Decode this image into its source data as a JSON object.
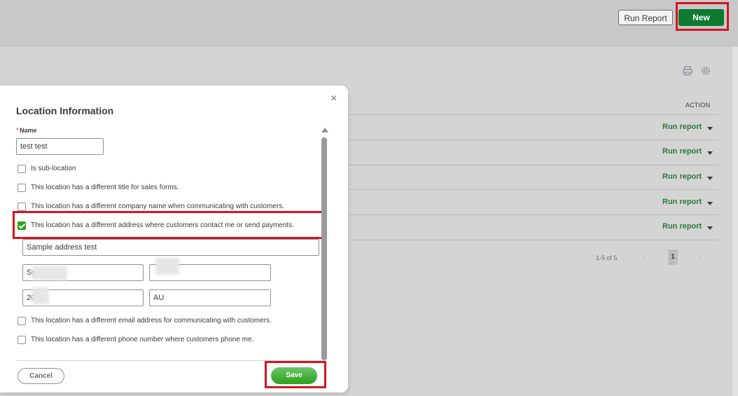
{
  "header": {
    "run_report_label": "Run Report",
    "new_label": "New"
  },
  "table": {
    "action_header": "ACTION",
    "rows": [
      {
        "action": "Run report"
      },
      {
        "action": "Run report"
      },
      {
        "action": "Run report"
      },
      {
        "action": "Run report"
      },
      {
        "action": "Run report"
      }
    ],
    "pager": {
      "range": "1-5 of 5",
      "prev": "‹",
      "current": "1",
      "next": "›"
    }
  },
  "dialog": {
    "title": "Location Information",
    "required_mark": "*",
    "name_label": "Name",
    "name_value": "test test",
    "checkboxes": [
      {
        "label": "Is sub-location",
        "checked": false
      },
      {
        "label": "This location has a different title for sales forms.",
        "checked": false
      },
      {
        "label": "This location has a different company name when communicating with customers.",
        "checked": false
      },
      {
        "label": "This location has a different address where customers contact me or send payments.",
        "checked": true
      },
      {
        "label": "This location has a different email address for communicating with customers.",
        "checked": false
      },
      {
        "label": "This location has a different phone number where customers phone me.",
        "checked": false
      }
    ],
    "address": {
      "street": "Sample address test",
      "city": "Sy",
      "state": "",
      "postcode": "20",
      "country": "AU"
    },
    "cancel_label": "Cancel",
    "save_label": "Save",
    "close_label": "×"
  },
  "colors": {
    "accent_green": "#2ca01c",
    "new_button": "#0e7a2f",
    "highlight_red": "#d4161c",
    "link_green": "#2b7a3b"
  }
}
